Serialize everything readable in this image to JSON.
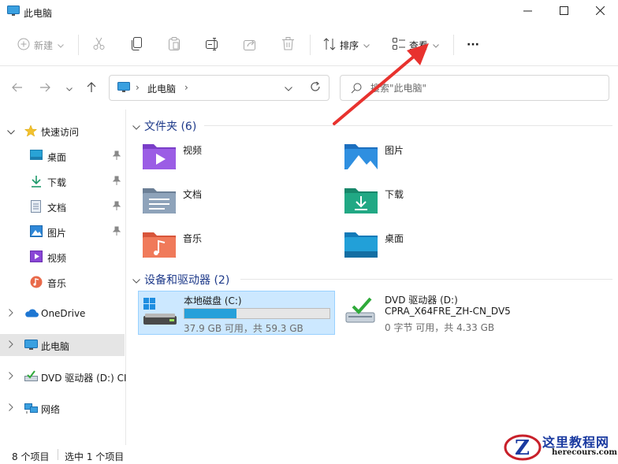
{
  "window": {
    "title": "此电脑",
    "minimize_icon": "minimize-icon",
    "maximize_icon": "maximize-icon",
    "close_icon": "close-icon"
  },
  "toolbar": {
    "new_label": "新建",
    "sort_label": "排序",
    "view_label": "查看",
    "more_label": "···"
  },
  "address": {
    "crumb": "此电脑",
    "separator": "›"
  },
  "search": {
    "placeholder": "搜索\"此电脑\""
  },
  "sidebar": {
    "items": [
      {
        "label": "快速访问",
        "icon": "star-icon"
      },
      {
        "label": "桌面",
        "icon": "desktop-icon"
      },
      {
        "label": "下载",
        "icon": "download-icon"
      },
      {
        "label": "文档",
        "icon": "document-icon"
      },
      {
        "label": "图片",
        "icon": "pictures-icon"
      },
      {
        "label": "视频",
        "icon": "videos-icon"
      },
      {
        "label": "音乐",
        "icon": "music-icon"
      },
      {
        "label": "OneDrive",
        "icon": "cloud-icon"
      },
      {
        "label": "此电脑",
        "icon": "computer-icon"
      },
      {
        "label": "DVD 驱动器 (D:) CI",
        "icon": "dvd-icon"
      },
      {
        "label": "网络",
        "icon": "network-icon"
      }
    ]
  },
  "content": {
    "folders_group": "文件夹 (6)",
    "folders": [
      {
        "label": "视频",
        "icon": "videos-folder-icon"
      },
      {
        "label": "图片",
        "icon": "pictures-folder-icon"
      },
      {
        "label": "文档",
        "icon": "documents-folder-icon"
      },
      {
        "label": "下载",
        "icon": "downloads-folder-icon"
      },
      {
        "label": "音乐",
        "icon": "music-folder-icon"
      },
      {
        "label": "桌面",
        "icon": "desktop-folder-icon"
      }
    ],
    "drives_group": "设备和驱动器 (2)",
    "drives": [
      {
        "name": "本地磁盘 (C:)",
        "used_fraction": 0.36,
        "size_text": "37.9 GB 可用，共 59.3 GB"
      },
      {
        "name": "DVD 驱动器 (D:)",
        "volume": "CPRA_X64FRE_ZH-CN_DV5",
        "size_text": "0 字节 可用，共 4.33 GB"
      }
    ]
  },
  "status": {
    "count": "8 个项目",
    "selected": "选中 1 个项目"
  },
  "watermark": {
    "title": "这里教程网",
    "url": "herecours.com"
  },
  "colors": {
    "accent": "#0067c0",
    "arrow": "#e8322e",
    "drive_fill": "#26a0da",
    "selection": "#cce8ff"
  }
}
